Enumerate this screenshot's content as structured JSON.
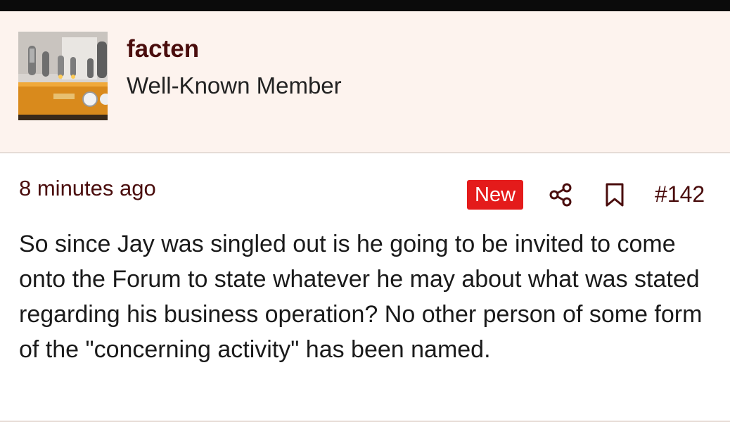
{
  "user": {
    "username": "facten",
    "title": "Well-Known Member",
    "avatar_icon": "tube-amplifier-photo"
  },
  "post": {
    "time": "8 minutes ago",
    "badge": "New",
    "share_icon": "share-icon",
    "bookmark_icon": "bookmark-icon",
    "number": "#142",
    "body": "So since Jay was singled out is he going to be invited to come onto the Forum to state whatever he may about what was stated regarding his business operation? No other person of some form of the \"concerning activity\" has been named."
  },
  "colors": {
    "accent": "#4a0d0d",
    "badge_bg": "#e41b1b",
    "header_bg": "#fdf3ee"
  }
}
